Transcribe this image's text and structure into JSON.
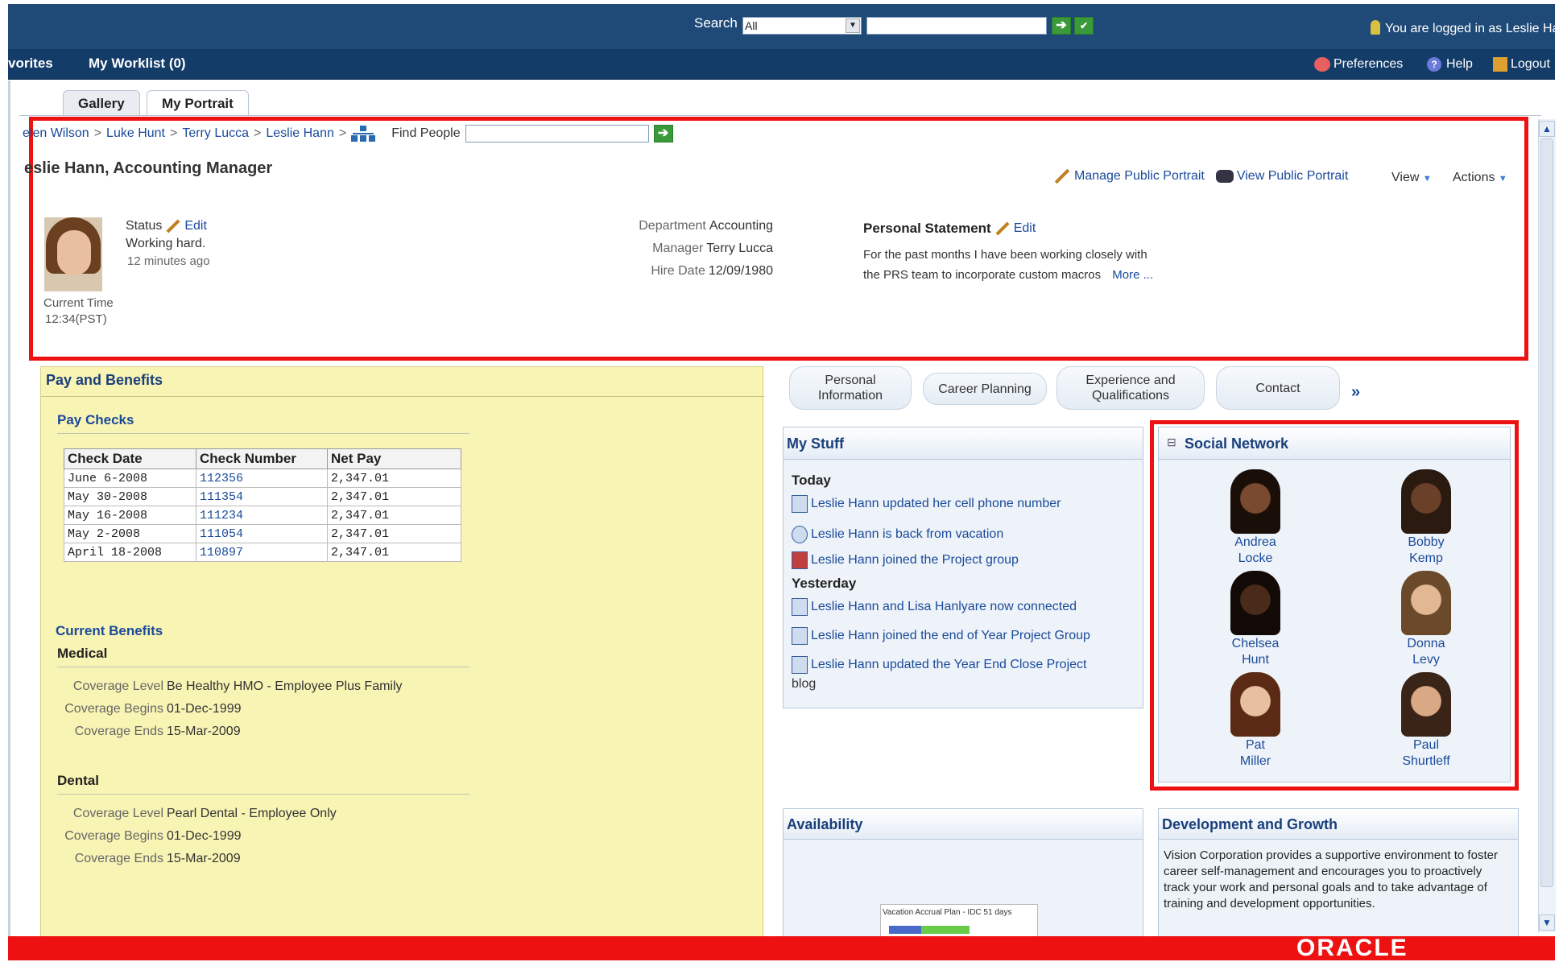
{
  "header": {
    "search_label": "Search",
    "search_scope": "All",
    "search_value": "",
    "logged_in_text": "You are logged in as Leslie Ha"
  },
  "nav": {
    "favorites": "vorites",
    "worklist": "My Worklist (0)",
    "preferences": "Preferences",
    "help": "Help",
    "logout": "Logout"
  },
  "tabs": [
    "Gallery",
    "My Portrait"
  ],
  "breadcrumb": [
    "elen Wilson",
    "Luke Hunt",
    "Terry Lucca",
    "Leslie Hann"
  ],
  "find_people": {
    "label": "Find People",
    "value": ""
  },
  "profile": {
    "title": "eslie Hann, Accounting Manager",
    "manage_public": "Manage Public Portrait",
    "view_public": "View Public Portrait",
    "view": "View",
    "actions": "Actions",
    "status_label": "Status",
    "status_edit": "Edit",
    "status_text": "Working hard.",
    "status_time": "12 minutes ago",
    "current_time_label": "Current Time",
    "current_time": "12:34(PST)",
    "department_label": "Department",
    "department": "Accounting",
    "manager_label": "Manager",
    "manager": "Terry Lucca",
    "hire_date_label": "Hire Date",
    "hire_date": "12/09/1980",
    "statement_label": "Personal Statement",
    "statement_edit": "Edit",
    "statement_line1": "For the past months I have been working closely with",
    "statement_line2": "the PRS team to incorporate custom macros",
    "statement_more": "More ..."
  },
  "pay": {
    "title": "Pay and Benefits",
    "checks_title": "Pay Checks",
    "columns": [
      "Check Date",
      "Check Number",
      "Net Pay"
    ],
    "rows": [
      [
        "June 6-2008",
        "112356",
        "2,347.01"
      ],
      [
        "May 30-2008",
        "111354",
        "2,347.01"
      ],
      [
        "May 16-2008",
        "111234",
        "2,347.01"
      ],
      [
        "May 2-2008",
        "111054",
        "2,347.01"
      ],
      [
        "April 18-2008",
        "110897",
        "2,347.01"
      ]
    ],
    "benefits_title": "Current Benefits",
    "medical_title": "Medical",
    "medical": {
      "level_label": "Coverage Level",
      "level": "Be Healthy HMO - Employee Plus Family",
      "begins_label": "Coverage Begins",
      "begins": "01-Dec-1999",
      "ends_label": "Coverage Ends",
      "ends": "15-Mar-2009"
    },
    "dental_title": "Dental",
    "dental": {
      "level_label": "Coverage Level",
      "level": "Pearl Dental - Employee Only",
      "begins_label": "Coverage Begins",
      "begins": "01-Dec-1999",
      "ends_label": "Coverage Ends",
      "ends": "15-Mar-2009"
    }
  },
  "subtabs": {
    "personal_1": "Personal",
    "personal_2": "Information",
    "career": "Career Planning",
    "experience_1": "Experience and",
    "experience_2": "Qualifications",
    "contact": "Contact",
    "more": "»"
  },
  "mystuff": {
    "title": "My Stuff",
    "today": "Today",
    "yesterday": "Yesterday",
    "items_today": [
      "Leslie Hann updated her cell phone number",
      "Leslie Hann is back from vacation",
      "Leslie Hann joined the Project group"
    ],
    "items_yesterday": [
      "Leslie Hann and Lisa Hanlyare now connected",
      "Leslie Hann joined the end of Year Project Group",
      "Leslie Hann updated the Year End Close Project"
    ],
    "last_wrap": "blog"
  },
  "social": {
    "title": "Social Network",
    "collapse": "⊟",
    "people": [
      {
        "first": "Andrea",
        "last": "Locke",
        "skin": "#7a4a30",
        "hair": "#1a0f08"
      },
      {
        "first": "Bobby",
        "last": "Kemp",
        "skin": "#6a4028",
        "hair": "#2a1a10"
      },
      {
        "first": "Chelsea",
        "last": "Hunt",
        "skin": "#4a2a1a",
        "hair": "#120a06"
      },
      {
        "first": "Donna",
        "last": "Levy",
        "skin": "#e2b894",
        "hair": "#6a4a2a"
      },
      {
        "first": "Pat",
        "last": "Miller",
        "skin": "#e8bfa0",
        "hair": "#5a2a14"
      },
      {
        "first": "Paul",
        "last": "Shurtleff",
        "skin": "#d9a884",
        "hair": "#3a2418"
      }
    ]
  },
  "availability": {
    "title": "Availability",
    "chart_caption": "Vacation Accrual Plan - IDC  51 days"
  },
  "development": {
    "title": "Development and Growth",
    "text": "Vision Corporation provides a supportive environment to foster career self-management and encourages you to proactively track your work and personal goals and to take advantage of training and development opportunities."
  },
  "footer": {
    "brand": "ORACLE"
  },
  "colors": {
    "accent_red": "#ee1111",
    "nav_blue": "#1f4a78",
    "pay_bg": "#f8f4b4"
  },
  "icons": {
    "scroll_up": "▲",
    "scroll_down": "▼",
    "go": "➔",
    "dropdown": "▼"
  }
}
